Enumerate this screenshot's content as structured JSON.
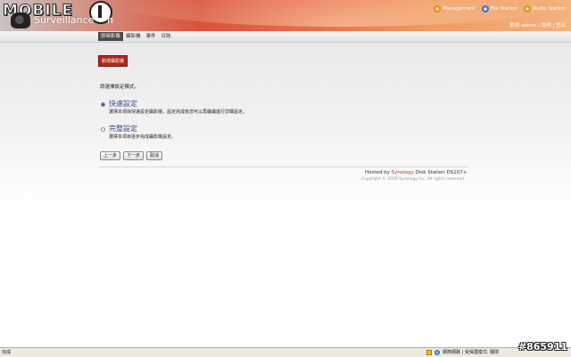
{
  "header": {
    "brand": "MOBILE",
    "app_title": "Surveillance",
    "app_title_suffix": "n",
    "links": [
      {
        "label": "Management",
        "icon": "management-icon"
      },
      {
        "label": "File Station",
        "icon": "file-station-icon"
      },
      {
        "label": "Audio Station",
        "icon": "audio-station-icon"
      }
    ],
    "user_links": "歡迎 admin | 說明 | 登出"
  },
  "nav": {
    "tabs": [
      "即時影像",
      "攝影機",
      "事件",
      "日誌"
    ],
    "active_index": 0
  },
  "main": {
    "section_badge": "新增攝影機",
    "prompt": "請選擇設定模式。",
    "options": [
      {
        "title": "快速設定",
        "desc": "選擇本項目快速設定攝影機，設定完成後您可以再繼續進行詳細設定。",
        "checked": true
      },
      {
        "title": "完整設定",
        "desc": "選擇本項目逐步完成攝影機設定。",
        "checked": false
      }
    ],
    "buttons": {
      "back": "上一步",
      "next": "下一步",
      "cancel": "取消"
    }
  },
  "footer": {
    "hosted_prefix": "Hosted by",
    "hosted_brand": "Synology",
    "hosted_suffix": "Disk Station DS107+",
    "copyright": "Copyright © 2008 Synology Inc. All rights reserved."
  },
  "statusbar": {
    "left": "完成",
    "right": "網際網路 | 受保護模式: 關閉"
  },
  "watermark": "#865911",
  "colors": {
    "accent": "#b2281c",
    "banner": "#d9523a",
    "link": "#3a4a8a",
    "synology": "#dd2222"
  }
}
